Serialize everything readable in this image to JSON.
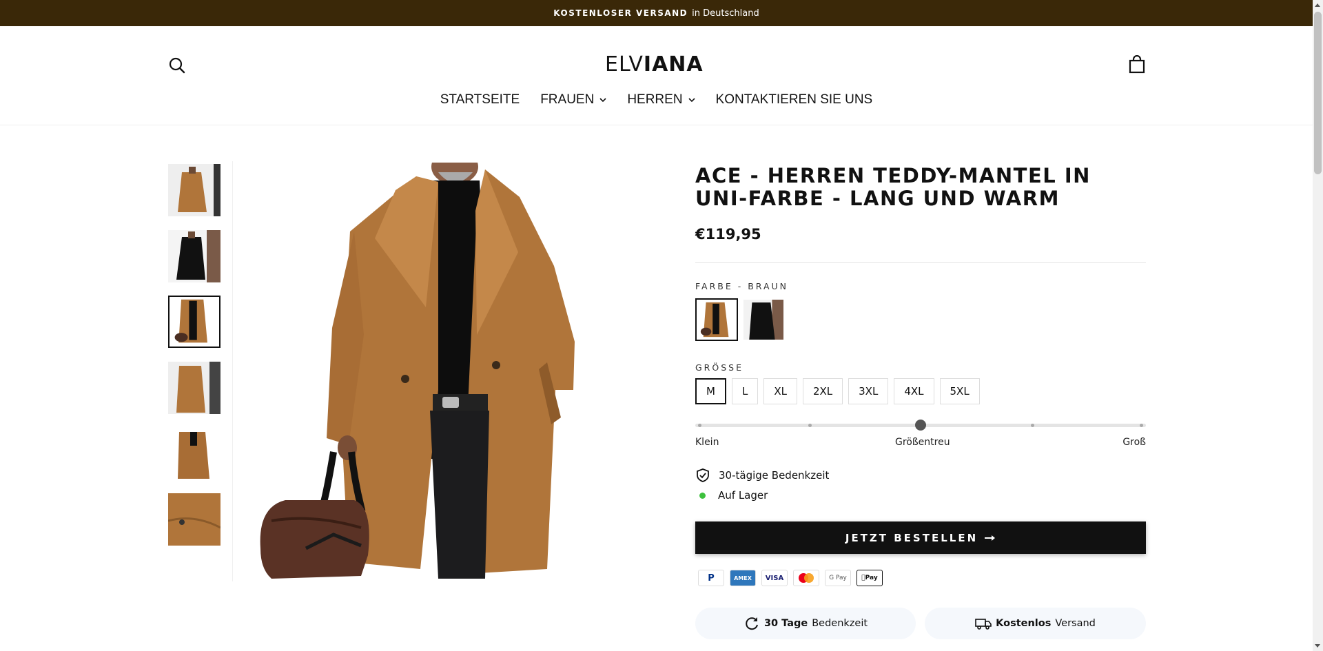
{
  "announcement": {
    "bold": "KOSTENLOSER VERSAND",
    "rest": "in Deutschland"
  },
  "header": {
    "logo_thin": "ELV",
    "logo_bold": "IANA",
    "nav": [
      {
        "label": "STARTSEITE",
        "has_dropdown": false
      },
      {
        "label": "FRAUEN",
        "has_dropdown": true
      },
      {
        "label": "HERREN",
        "has_dropdown": true
      },
      {
        "label": "KONTAKTIEREN SIE UNS",
        "has_dropdown": false
      }
    ]
  },
  "product": {
    "title": "ACE - HERREN TEDDY-MANTEL IN UNI-FARBE - LANG UND WARM",
    "price": "€119,95",
    "color_label": "FARBE - BRAUN",
    "colors": [
      "Braun",
      "Schwarz"
    ],
    "size_label": "GRÖSSE",
    "sizes": [
      "M",
      "L",
      "XL",
      "2XL",
      "3XL",
      "4XL",
      "5XL"
    ],
    "selected_size": "M",
    "fit": {
      "low": "Klein",
      "mid": "Größentreu",
      "high": "Groß",
      "value_fraction": 0.5
    },
    "features": [
      "30-tägige Bedenkzeit",
      "Auf Lager"
    ],
    "buy_label": "JETZT BESTELLEN",
    "payments": [
      "PayPal",
      "AMEX",
      "VISA",
      "Mastercard",
      "G Pay",
      "Apple Pay"
    ],
    "pills": [
      {
        "bold": "30 Tage",
        "rest": "Bedenkzeit"
      },
      {
        "bold": "Kostenlos",
        "rest": "Versand"
      }
    ]
  },
  "colors": {
    "announce_bg": "#3a2808",
    "coat": "#b0753a",
    "button": "#111111",
    "in_stock": "#3ec13e"
  }
}
